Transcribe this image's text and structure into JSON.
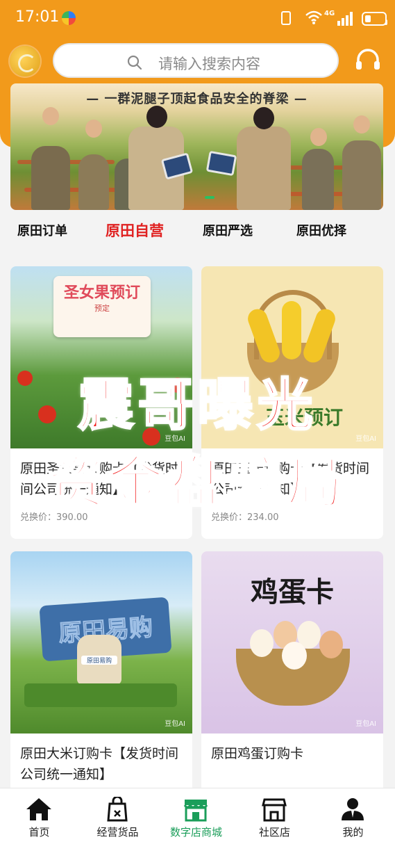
{
  "status_bar": {
    "time": "17:01",
    "network": "4G"
  },
  "search": {
    "placeholder": "请输入搜索内容"
  },
  "banner": {
    "title": "— 一群泥腿子顶起食品安全的脊梁 —"
  },
  "tabs": [
    {
      "label": "原田订单",
      "active": false
    },
    {
      "label": "原田自营",
      "active": true
    },
    {
      "label": "原田严选",
      "active": false
    },
    {
      "label": "原田优择",
      "active": false
    }
  ],
  "products": [
    {
      "title": "原田圣女果订购卡【发货时间公司统一通知】",
      "price": "兑换价：390.00",
      "image_text": "圣女果预订",
      "image_subtext": "预定",
      "ai_tag": "豆包AI"
    },
    {
      "title": "原田玉米订购卡【发货时间公司统一通知】",
      "price": "兑换价：234.00",
      "image_text": "玉米预订",
      "ai_tag": "豆包AI"
    },
    {
      "title": "原田大米订购卡【发货时间公司统一通知】",
      "price": "",
      "image_text": "原田易购",
      "image_subtext": "原田易购",
      "ai_tag": "豆包AI"
    },
    {
      "title": "原田鸡蛋订购卡",
      "price": "",
      "image_text": "鸡蛋卡",
      "ai_tag": "豆包AI"
    }
  ],
  "overlay": {
    "line1": "震哥曝光",
    "line2": "资金盘骗局"
  },
  "bottom_nav": [
    {
      "label": "首页",
      "icon": "home-icon"
    },
    {
      "label": "经营货品",
      "icon": "goods-bag-icon"
    },
    {
      "label": "数字店商城",
      "icon": "store-icon",
      "active": true
    },
    {
      "label": "社区店",
      "icon": "community-store-icon"
    },
    {
      "label": "我的",
      "icon": "profile-icon"
    }
  ],
  "colors": {
    "header": "#f29a1b",
    "active_tab": "#e02222",
    "active_nav": "#1b9e5a",
    "overlay_text": "#f21c1c"
  }
}
